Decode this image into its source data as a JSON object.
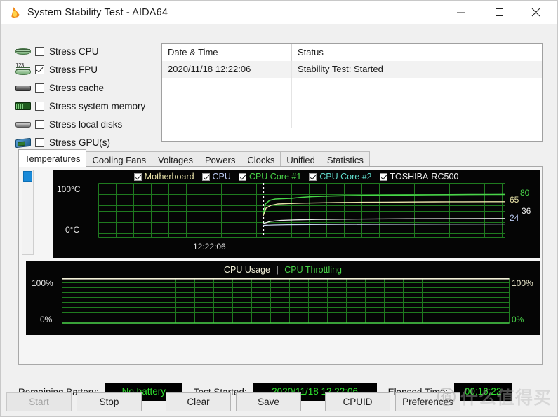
{
  "window": {
    "title": "System Stability Test - AIDA64",
    "app_icon": "flame-icon",
    "minimize_label": "—",
    "maximize_label": "□",
    "close_label": "✕"
  },
  "stress_options": [
    {
      "label": "Stress CPU",
      "checked": false,
      "icon": "cpu-icon"
    },
    {
      "label": "Stress FPU",
      "checked": true,
      "icon": "fpu-icon"
    },
    {
      "label": "Stress cache",
      "checked": false,
      "icon": "cache-icon"
    },
    {
      "label": "Stress system memory",
      "checked": false,
      "icon": "memory-icon"
    },
    {
      "label": "Stress local disks",
      "checked": false,
      "icon": "disk-icon"
    },
    {
      "label": "Stress GPU(s)",
      "checked": false,
      "icon": "gpu-icon"
    }
  ],
  "log": {
    "columns": [
      "Date & Time",
      "Status"
    ],
    "rows": [
      {
        "datetime": "2020/11/18 12:22:06",
        "status": "Stability Test: Started"
      }
    ]
  },
  "tabs": [
    {
      "label": "Temperatures",
      "active": true
    },
    {
      "label": "Cooling Fans",
      "active": false
    },
    {
      "label": "Voltages",
      "active": false
    },
    {
      "label": "Powers",
      "active": false
    },
    {
      "label": "Clocks",
      "active": false
    },
    {
      "label": "Unified",
      "active": false
    },
    {
      "label": "Statistics",
      "active": false
    }
  ],
  "temperature_legend": [
    {
      "label": "Motherboard",
      "checked": true,
      "color": "#e8e2a8"
    },
    {
      "label": "CPU",
      "checked": true,
      "color": "#b8c8f0"
    },
    {
      "label": "CPU Core #1",
      "checked": true,
      "color": "#49d449"
    },
    {
      "label": "CPU Core #2",
      "checked": true,
      "color": "#5fd8c8"
    },
    {
      "label": "TOSHIBA-RC500",
      "checked": true,
      "color": "#eeeeee"
    }
  ],
  "status": {
    "battery_label": "Remaining Battery:",
    "battery_value": "No battery",
    "started_label": "Test Started:",
    "started_value": "2020/11/18 12:22:06",
    "elapsed_label": "Elapsed Time:",
    "elapsed_value": "00:16:22",
    "value_color": "#2ee02e"
  },
  "buttons": [
    {
      "label": "Start",
      "disabled": true
    },
    {
      "label": "Stop",
      "disabled": false
    },
    {
      "label": "Clear",
      "disabled": false
    },
    {
      "label": "Save",
      "disabled": false
    },
    {
      "label": "CPUID",
      "disabled": false
    },
    {
      "label": "Preferences",
      "disabled": false
    }
  ],
  "watermark": {
    "badge": "值",
    "text": "什么值得买"
  },
  "chart_data": [
    {
      "type": "line",
      "title": "Temperatures",
      "xlabel": "",
      "ylabel": "",
      "ylim": [
        0,
        100
      ],
      "y_ticks": [
        "100°C",
        "0°C"
      ],
      "grid": true,
      "x_annotation": "12:22:06",
      "marker_line": "dashed-vertical-at-test-start",
      "right_value_labels": [
        {
          "value": "80",
          "color": "#49d449"
        },
        {
          "value": "65",
          "color": "#e8e2a8"
        },
        {
          "value": "36",
          "color": "#eeeeee"
        },
        {
          "value": "24",
          "color": "#b8c8f0"
        }
      ],
      "series": [
        {
          "name": "CPU Core #1",
          "color": "#49d449",
          "final": 80,
          "baseline": 42
        },
        {
          "name": "Motherboard",
          "color": "#e8e2a8",
          "final": 65,
          "baseline": 40
        },
        {
          "name": "TOSHIBA-RC500",
          "color": "#eeeeee",
          "final": 36,
          "baseline": 30
        },
        {
          "name": "CPU",
          "color": "#b8c8f0",
          "final": 24,
          "baseline": 24
        }
      ]
    },
    {
      "type": "line",
      "title": "CPU Usage  |  CPU Throttling",
      "title_parts": [
        "CPU Usage",
        "|",
        "CPU Throttling"
      ],
      "ylim": [
        0,
        100
      ],
      "y_ticks_left": [
        "100%",
        "0%"
      ],
      "y_ticks_right": [
        "100%",
        "0%"
      ],
      "grid": true,
      "series": [
        {
          "name": "CPU Usage",
          "color": "#f2f0d8",
          "values": [
            100
          ]
        },
        {
          "name": "CPU Throttling",
          "color": "#49d449",
          "values": [
            0
          ]
        }
      ]
    }
  ]
}
